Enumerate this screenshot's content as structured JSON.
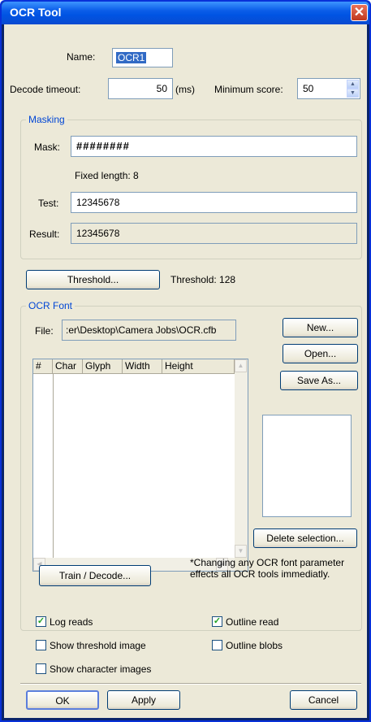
{
  "window": {
    "title": "OCR Tool",
    "close_glyph": "✕"
  },
  "name": {
    "label": "Name:",
    "value": "OCR1"
  },
  "decode_timeout": {
    "label": "Decode timeout:",
    "value": "50",
    "unit": "(ms)"
  },
  "minimum_score": {
    "label": "Minimum score:",
    "value": "50"
  },
  "masking": {
    "legend": "Masking",
    "mask_label": "Mask:",
    "mask_value": "########",
    "fixed_length": "Fixed length: 8",
    "test_label": "Test:",
    "test_value": "12345678",
    "result_label": "Result:",
    "result_value": "12345678"
  },
  "threshold": {
    "button": "Threshold...",
    "text": "Threshold: 128"
  },
  "ocr_font": {
    "legend": "OCR Font",
    "file_label": "File:",
    "file_value": ":er\\Desktop\\Camera Jobs\\OCR.cfb",
    "new_button": "New...",
    "open_button": "Open...",
    "save_as_button": "Save As...",
    "columns": [
      "#",
      "Char",
      "Glyph",
      "Width",
      "Height"
    ],
    "delete_button": "Delete selection...",
    "train_button": "Train / Decode...",
    "note": "*Changing any OCR font parameter effects all OCR tools immediatly."
  },
  "options": {
    "log_reads": "Log reads",
    "outline_read": "Outline read",
    "show_threshold": "Show threshold image",
    "outline_blobs": "Outline blobs",
    "show_chars": "Show character images",
    "check_glyph": "✓"
  },
  "footer": {
    "ok": "OK",
    "apply": "Apply",
    "cancel": "Cancel"
  }
}
